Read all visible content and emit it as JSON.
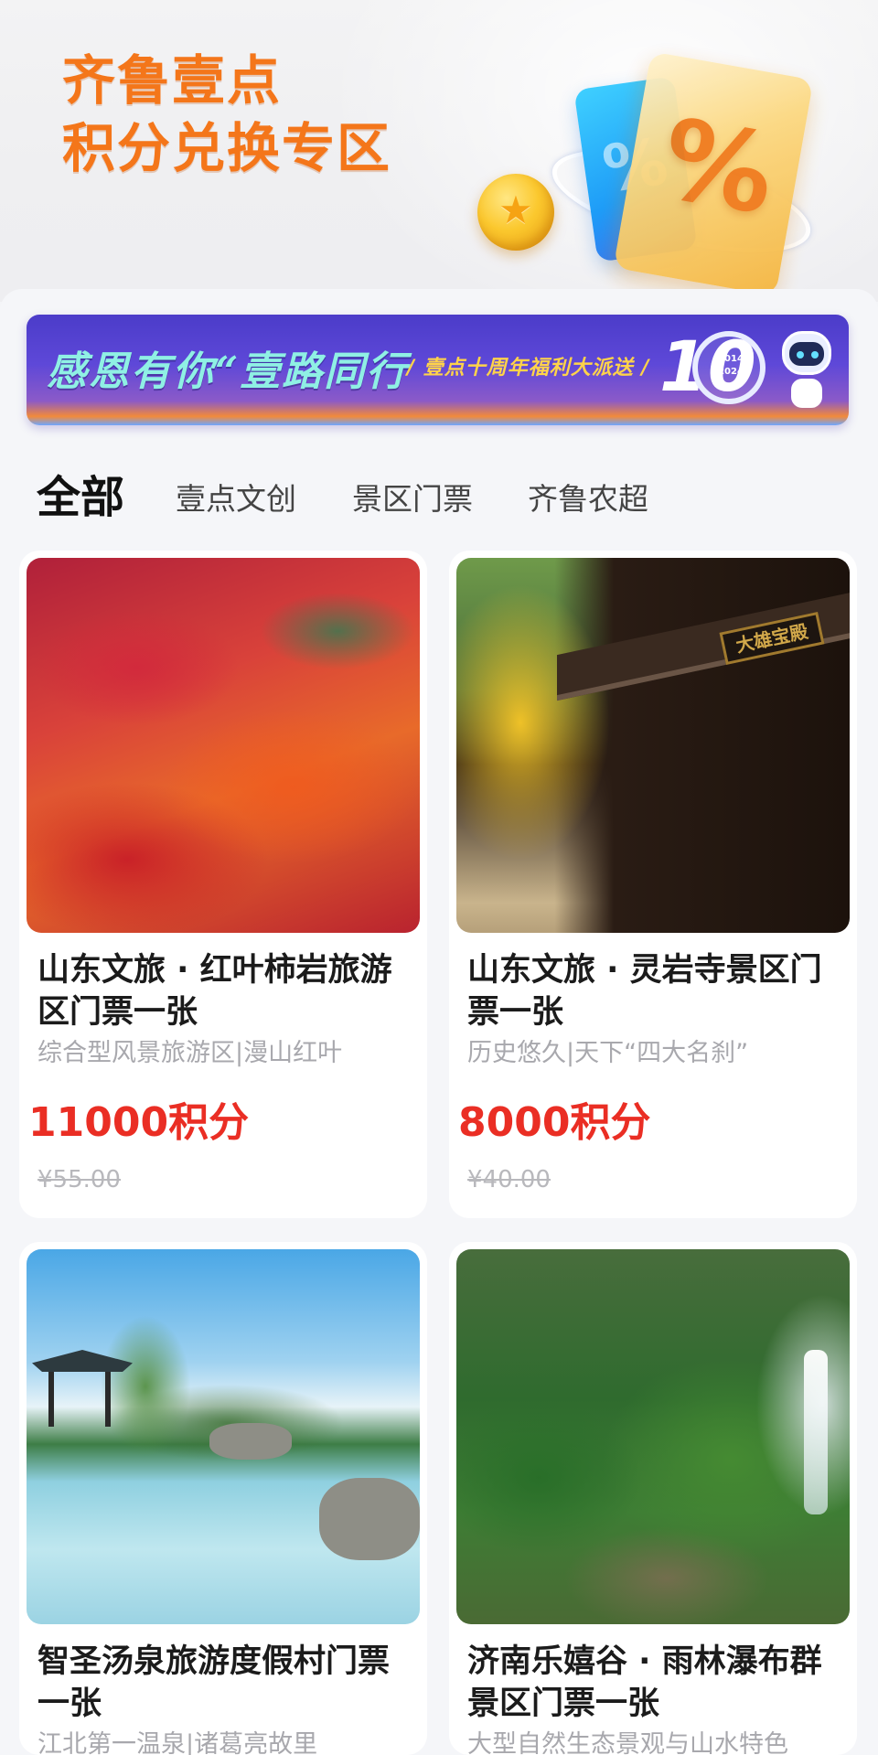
{
  "hero": {
    "title_line1": "齐鲁壹点",
    "title_line2": "积分兑换专区",
    "accent_color": "#f4761a"
  },
  "banner": {
    "main_text": "感恩有你“壹路同行",
    "sub_text": "/ 壹点十周年福利大派送 /",
    "badge_number": "10",
    "badge_years": "2014 2024"
  },
  "tabs": [
    {
      "label": "全部",
      "active": true
    },
    {
      "label": "壹点文创",
      "active": false
    },
    {
      "label": "景区门票",
      "active": false
    },
    {
      "label": "齐鲁农超",
      "active": false
    }
  ],
  "products": [
    {
      "title": "山东文旅 · 红叶柿岩旅游区门票一张",
      "subtitle": "综合型风景旅游区|漫山红叶",
      "points": "11000积分",
      "original_price": "¥55.00",
      "image": "red-leaf-mountain"
    },
    {
      "title": "山东文旅 · 灵岩寺景区门票一张",
      "subtitle": "历史悠久|天下“四大名刹”",
      "points": "8000积分",
      "original_price": "¥40.00",
      "image": "temple-ginkgo",
      "plaque_text": "大雄宝殿"
    },
    {
      "title": "智圣汤泉旅游度假村门票一张",
      "subtitle": "江北第一温泉|诸葛亮故里",
      "image": "hot-spring"
    },
    {
      "title": "济南乐嬉谷 · 雨林瀑布群景区门票一张",
      "subtitle": "大型自然生态景观与山水特色",
      "image": "rainforest-waterfall"
    }
  ],
  "colors": {
    "price_red": "#ea2e24",
    "tab_underline": "#ffb53d",
    "page_bg": "#f5f6f9"
  }
}
